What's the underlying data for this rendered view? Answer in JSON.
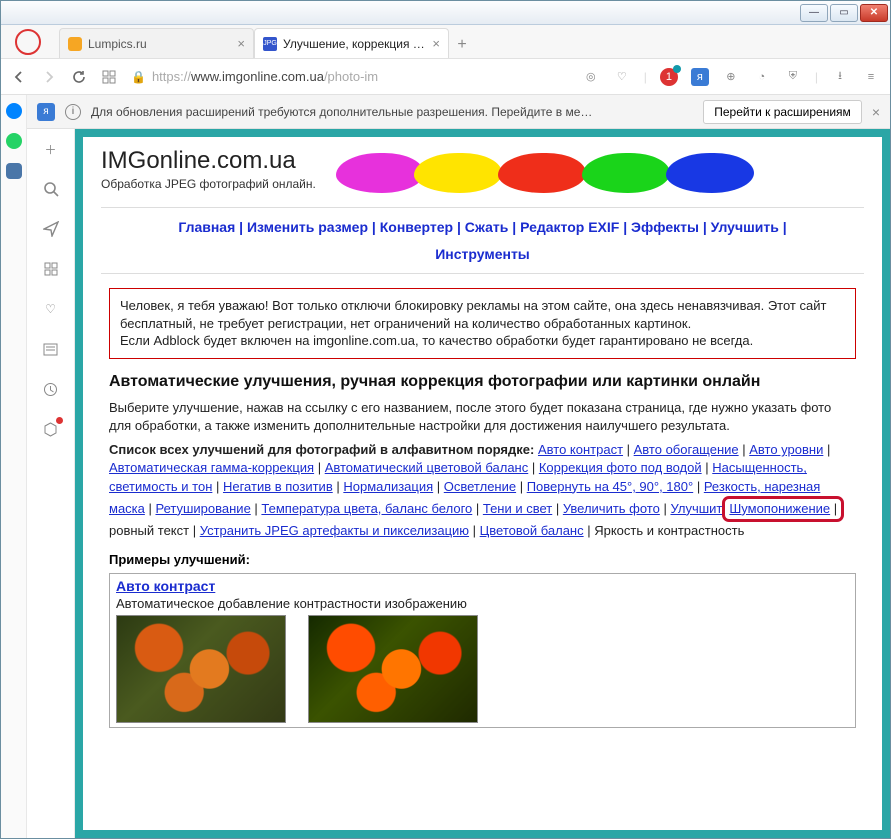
{
  "window_controls": {
    "min": "—",
    "max": "▭",
    "close": "✕"
  },
  "tabs": [
    {
      "title": "Lumpics.ru",
      "favicon_text": ""
    },
    {
      "title": "Улучшение, коррекция ф…",
      "favicon_text": "JPG"
    }
  ],
  "address": {
    "proto": "https://",
    "host": "www.imgonline.com.ua",
    "path": "/photo-im"
  },
  "notification": {
    "text": "Для обновления расширений требуются дополнительные разрешения. Перейдите в ме…",
    "button": "Перейти к расширениям"
  },
  "site": {
    "title": "IMGonline.com.ua",
    "subtitle": "Обработка JPEG фотографий онлайн."
  },
  "menu": {
    "items": [
      "Главная",
      "Изменить размер",
      "Конвертер",
      "Сжать",
      "Редактор EXIF",
      "Эффекты",
      "Улучшить",
      "Инструменты"
    ]
  },
  "redbox": {
    "p1": "Человек, я тебя уважаю! Вот только отключи блокировку рекламы на этом сайте, она здесь ненавязчивая. Этот сайт бесплатный, не требует регистрации, нет ограничений на количество обработанных картинок.",
    "p2": "Если Adblock будет включен на imgonline.com.ua, то качество обработки будет гарантировано не всегда."
  },
  "heading": "Автоматические улучшения, ручная коррекция фотографии или картинки онлайн",
  "intro": "Выберите улучшение, нажав на ссылку с его названием, после этого будет показана страница, где нужно указать фото для обработки, а также изменить дополнительные настройки для достижения наилучшего результата.",
  "list_label": "Список всех улучшений для фотографий в алфавитном порядке:",
  "links": {
    "l1": "Авто контраст",
    "l2": "Авто обогащение",
    "l3": "Авто уровни",
    "l4": "Автоматическая гамма-коррекция",
    "l5": "Автоматический цветовой баланс",
    "l6": "Коррекция фото под водой",
    "l7": "Насыщенность, светимость и тон",
    "l8": "Негатив в позитив",
    "l9": "Нормализация",
    "l10": "Осветление",
    "l11": "Повернуть на 45°, 90°, 180°",
    "l12": "Резкость, нарезная маска",
    "l13": "Ретуширование",
    "l14": "Температура цвета, баланс белого",
    "l15": "Тени и свет",
    "l16": "Увеличить фото",
    "l17_a": "Улучшит",
    "l17_b": "ровный текст",
    "l18": "Устранить JPEG артефакты и пикселизацию",
    "l19": "Цветовой баланс",
    "l20": "Шумопонижение",
    "l21": "Яркость и контрастность"
  },
  "examples_label": "Примеры улучшений:",
  "example1": {
    "title": "Авто контраст",
    "desc": "Автоматическое добавление контрастности изображению"
  }
}
